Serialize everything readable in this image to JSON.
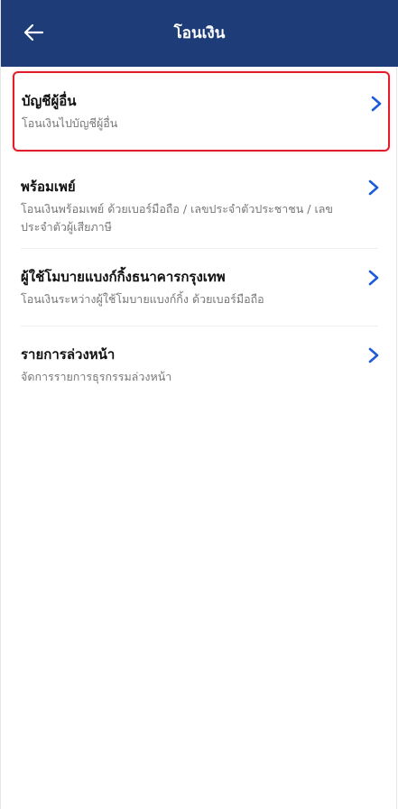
{
  "header": {
    "title": "โอนเงิน",
    "back_icon": "arrow-left-icon",
    "background": "#1e3c78"
  },
  "items": [
    {
      "title": "บัญชีผู้อื่น",
      "description": "โอนเงินไปบัญชีผู้อื่น",
      "highlighted": true,
      "highlight_color": "#e21d2b"
    },
    {
      "title": "พร้อมเพย์",
      "description": "โอนเงินพร้อมเพย์ ด้วยเบอร์มือถือ / เลขประจำตัวประชาชน / เลขประจำตัวผู้เสียภาษี"
    },
    {
      "title": "ผู้ใช้โมบายแบงก์กิ้งธนาคารกรุงเทพ",
      "description": "โอนเงินระหว่างผู้ใช้โมบายแบงก์กิ้ง ด้วยเบอร์มือถือ"
    },
    {
      "title": "รายการล่วงหน้า",
      "description": "จัดการรายการธุรกรรมล่วงหน้า"
    }
  ],
  "colors": {
    "accent": "#1e5bd8",
    "title_text": "#111111",
    "description_text": "#777777"
  }
}
